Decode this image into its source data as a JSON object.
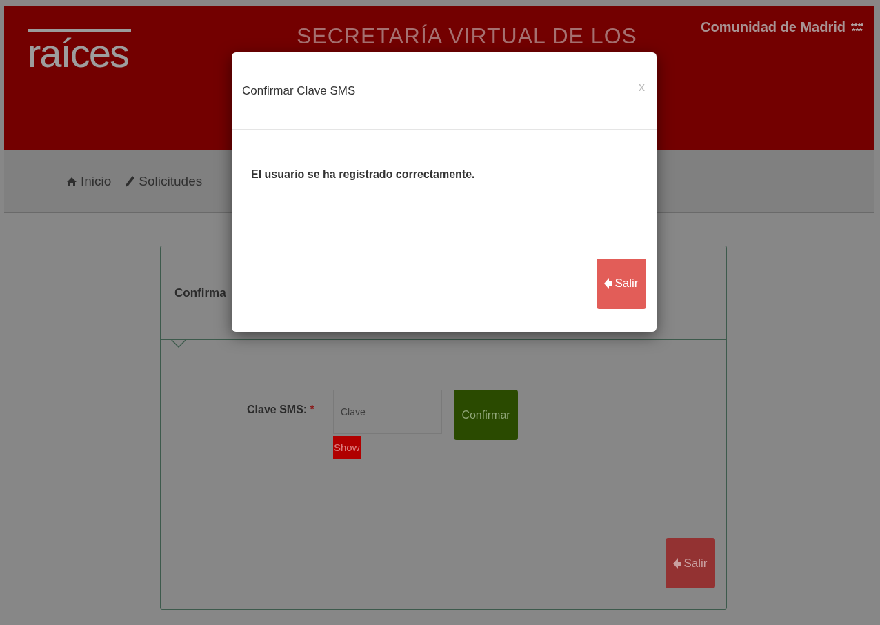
{
  "header": {
    "logo": "raíces",
    "title": "SECRETARÍA VIRTUAL DE LOS",
    "region": "Comunidad de Madrid"
  },
  "nav": [
    {
      "label": "Inicio"
    },
    {
      "label": "Solicitudes"
    }
  ],
  "card": {
    "title": "Confirma",
    "field": {
      "label": "Clave SMS:",
      "required_mark": "*",
      "placeholder": "Clave"
    },
    "confirm_button": "Confirmar",
    "show_button": "Show",
    "exit_button": "Salir"
  },
  "modal": {
    "title": "Confirmar Clave SMS",
    "close": "x",
    "message": "El usuario se ha registrado correctamente.",
    "exit_button": "Salir"
  }
}
